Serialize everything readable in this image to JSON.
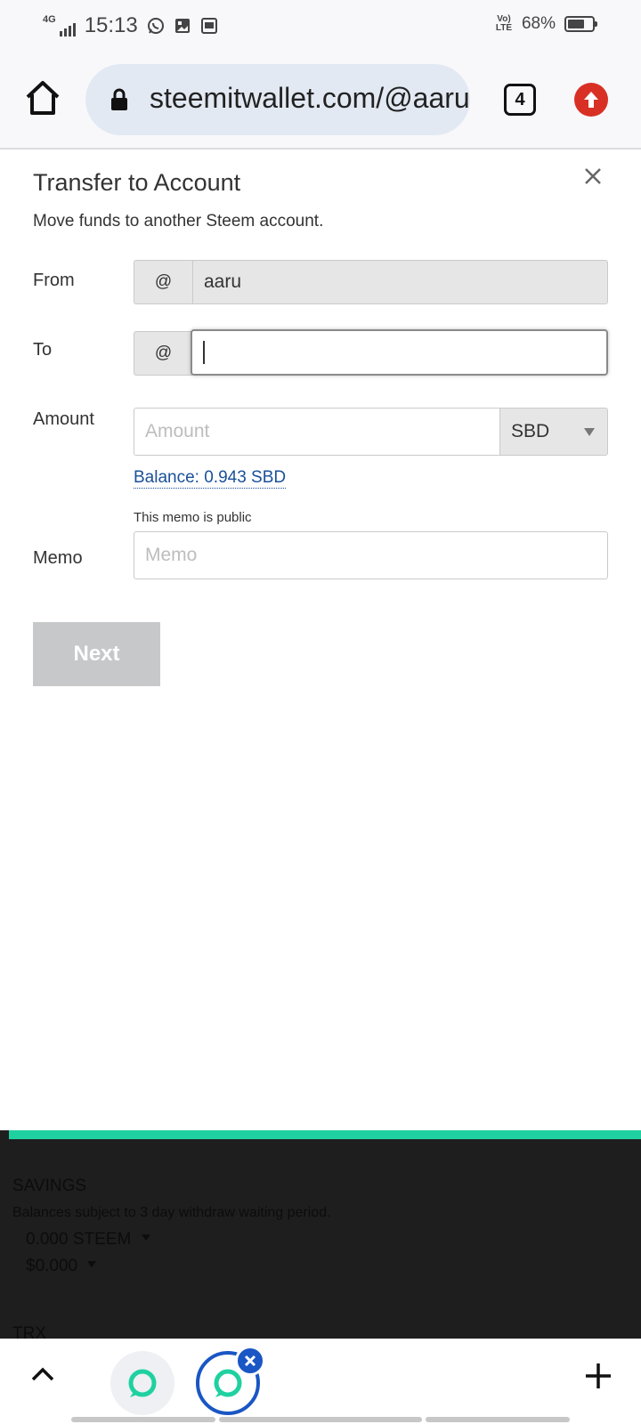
{
  "statusbar": {
    "network": "4G",
    "time": "15:13",
    "volte": "Vo) LTE",
    "battery": "68%",
    "battery_level": 0.68
  },
  "browser": {
    "url": "steemitwallet.com/@aaru",
    "tab_count": "4"
  },
  "modal": {
    "title": "Transfer to Account",
    "subtitle": "Move funds to another Steem account.",
    "from": {
      "label": "From",
      "prefix": "@",
      "value": "aaru"
    },
    "to": {
      "label": "To",
      "prefix": "@",
      "value": ""
    },
    "amount": {
      "label": "Amount",
      "placeholder": "Amount",
      "currency": "SBD"
    },
    "balance": "Balance: 0.943 SBD",
    "memo": {
      "label": "Memo",
      "note": "This memo is public",
      "placeholder": "Memo"
    },
    "next_label": "Next"
  },
  "background_page": {
    "savings_heading": "SAVINGS",
    "savings_note": "Balances subject to 3 day withdraw waiting period.",
    "steem_value": "0.000 STEEM",
    "usd_value": "$0.000",
    "trx_heading": "TRX"
  },
  "colors": {
    "accent_green": "#1fd1a0",
    "link_blue": "#1a5099",
    "update_red": "#d93025",
    "tab_blue": "#1a56c4"
  }
}
